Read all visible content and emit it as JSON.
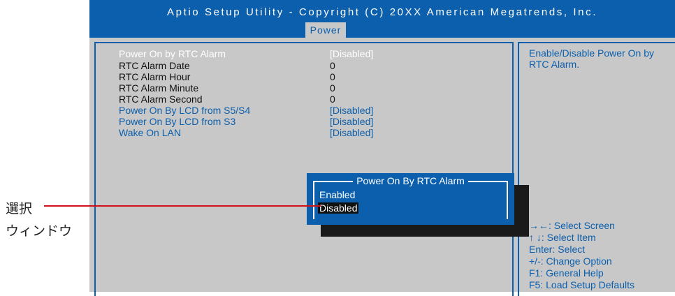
{
  "header": {
    "title": "Aptio Setup Utility - Copyright (C) 20XX American Megatrends, Inc.",
    "active_tab": "Power"
  },
  "settings": [
    {
      "label": "Power On by RTC Alarm",
      "value": "[Disabled]",
      "state": "selected"
    },
    {
      "label": "RTC Alarm Date",
      "value": "0",
      "state": "normal"
    },
    {
      "label": "RTC Alarm Hour",
      "value": "0",
      "state": "normal"
    },
    {
      "label": "RTC Alarm Minute",
      "value": "0",
      "state": "normal"
    },
    {
      "label": "RTC Alarm Second",
      "value": "0",
      "state": "normal"
    },
    {
      "label": "Power On By LCD from S5/S4",
      "value": "[Disabled]",
      "state": "option"
    },
    {
      "label": "Power On By LCD from S3",
      "value": "[Disabled]",
      "state": "option"
    },
    {
      "label": "Wake On LAN",
      "value": "[Disabled]",
      "state": "option"
    }
  ],
  "help_text": "Enable/Disable Power On by RTC Alarm.",
  "key_help": [
    "→←: Select Screen",
    "↑ ↓: Select Item",
    "Enter: Select",
    "+/-: Change Option",
    "F1: General Help",
    "F5: Load Setup Defaults"
  ],
  "popup": {
    "title": "Power On By RTC Alarm",
    "options": [
      "Enabled",
      "Disabled"
    ],
    "selected": "Disabled"
  },
  "callout": {
    "line1": "選択",
    "line2": "ウィンドウ"
  },
  "colors": {
    "accent": "#0b5fad",
    "panel_bg": "#c8c8c8",
    "callout_line": "#d0121b"
  }
}
